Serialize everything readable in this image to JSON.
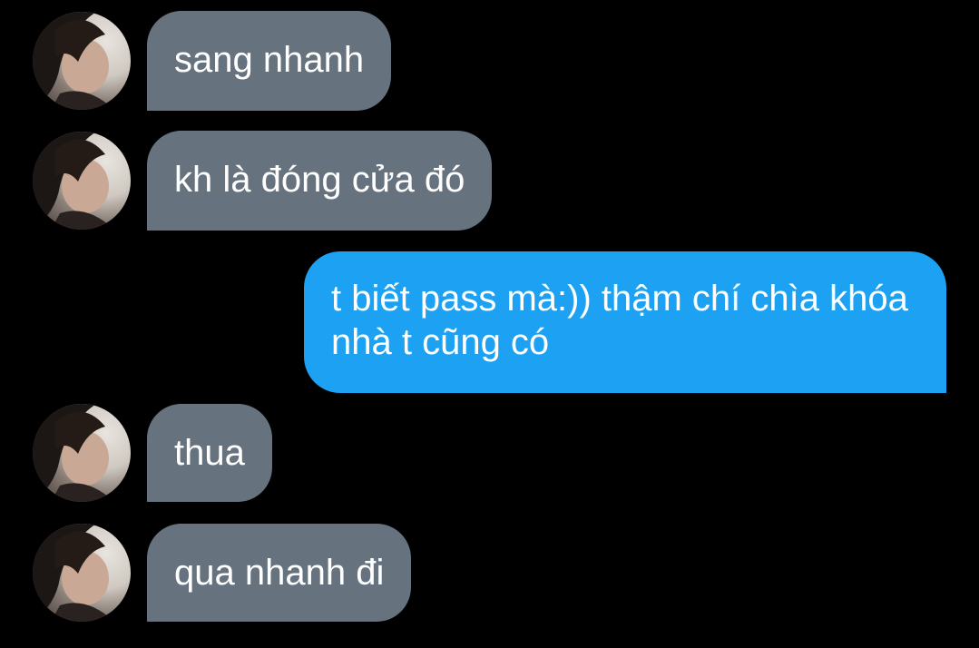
{
  "conversation": {
    "messages": [
      {
        "sender": "other",
        "text": "sang nhanh"
      },
      {
        "sender": "other",
        "text": "kh là đóng cửa đó"
      },
      {
        "sender": "me",
        "text": "t biết pass mà:)) thậm chí chìa khóa nhà t cũng có"
      },
      {
        "sender": "other",
        "text": "thua"
      },
      {
        "sender": "other",
        "text": "qua nhanh đi"
      }
    ]
  },
  "colors": {
    "background": "#000000",
    "incoming_bubble": "#66737f",
    "outgoing_bubble": "#1da1f2",
    "text": "#ffffff"
  },
  "icons": {
    "avatar": "user-avatar-photo"
  }
}
